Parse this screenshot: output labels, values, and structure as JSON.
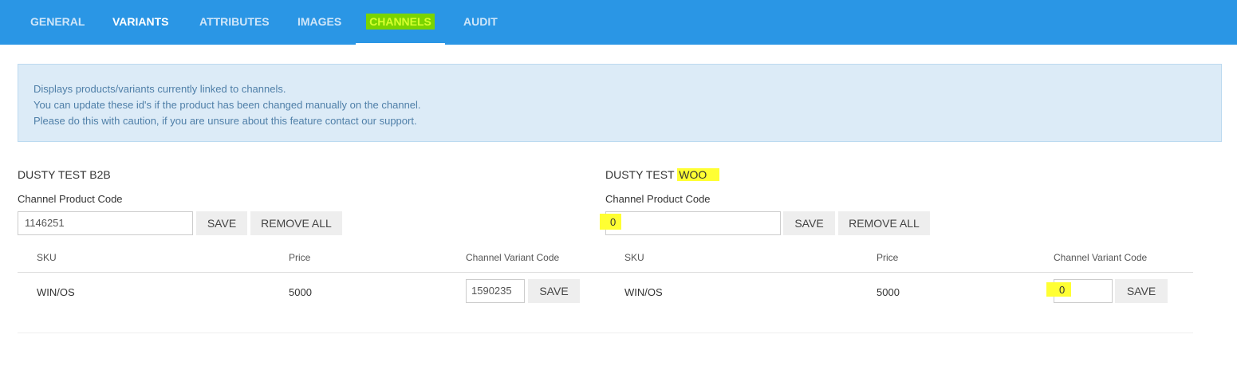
{
  "tabs": [
    {
      "label": "GENERAL"
    },
    {
      "label": "VARIANTS"
    },
    {
      "label": "ATTRIBUTES"
    },
    {
      "label": "IMAGES"
    },
    {
      "label": "CHANNELS"
    },
    {
      "label": "AUDIT"
    }
  ],
  "info": {
    "line1": "Displays products/variants currently linked to channels.",
    "line2": "You can update these id's if the product has been changed manually on the channel.",
    "line3": "Please do this with caution, if you are unsure about this feature contact our support."
  },
  "channels": [
    {
      "title": "DUSTY TEST B2B",
      "product_code_label": "Channel Product Code",
      "product_code_value": "1146251",
      "save_label": "SAVE",
      "remove_all_label": "REMOVE ALL",
      "headers": {
        "sku": "SKU",
        "price": "Price",
        "variant_code": "Channel Variant Code"
      },
      "row": {
        "sku": "WIN/OS",
        "price": "5000",
        "variant_code": "1590235",
        "save_label": "SAVE"
      }
    },
    {
      "title_prefix": "DUSTY TEST ",
      "title_highlight": "WOO",
      "product_code_label": "Channel Product Code",
      "product_code_value": "0",
      "save_label": "SAVE",
      "remove_all_label": "REMOVE ALL",
      "headers": {
        "sku": "SKU",
        "price": "Price",
        "variant_code": "Channel Variant Code"
      },
      "row": {
        "sku": "WIN/OS",
        "price": "5000",
        "variant_code": "0",
        "save_label": "SAVE"
      }
    }
  ],
  "colors": {
    "tab_bar": "#2a96e5",
    "highlight_green": "#7ad400",
    "highlight_yellow": "#ffff33",
    "info_background": "#dcebf7"
  }
}
